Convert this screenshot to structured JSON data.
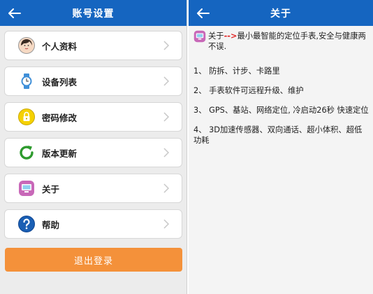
{
  "account": {
    "title": "账号设置",
    "items": [
      {
        "label": "个人资料",
        "icon": "avatar-icon"
      },
      {
        "label": "设备列表",
        "icon": "watch-icon"
      },
      {
        "label": "密码修改",
        "icon": "lock-icon"
      },
      {
        "label": "版本更新",
        "icon": "refresh-icon"
      },
      {
        "label": "关于",
        "icon": "monitor-icon"
      },
      {
        "label": "帮助",
        "icon": "help-icon"
      }
    ],
    "logout_label": "退出登录"
  },
  "about": {
    "title": "关于",
    "intro_prefix": "关于",
    "intro_arrow": "-->",
    "intro_rest": "最小最智能的定位手表,安全与健康两不误.",
    "points": [
      "1、 防拆、计步、卡路里",
      "2、 手表软件可远程升级、维护",
      "3、 GPS、基站、网络定位, 冷启动26秒 快速定位",
      "4、 3D加速传感器、双向通话、超小体积、超低功耗"
    ]
  },
  "colors": {
    "appbar": "#1565c0",
    "logout": "#f4913a",
    "arrow": "#e02020"
  }
}
